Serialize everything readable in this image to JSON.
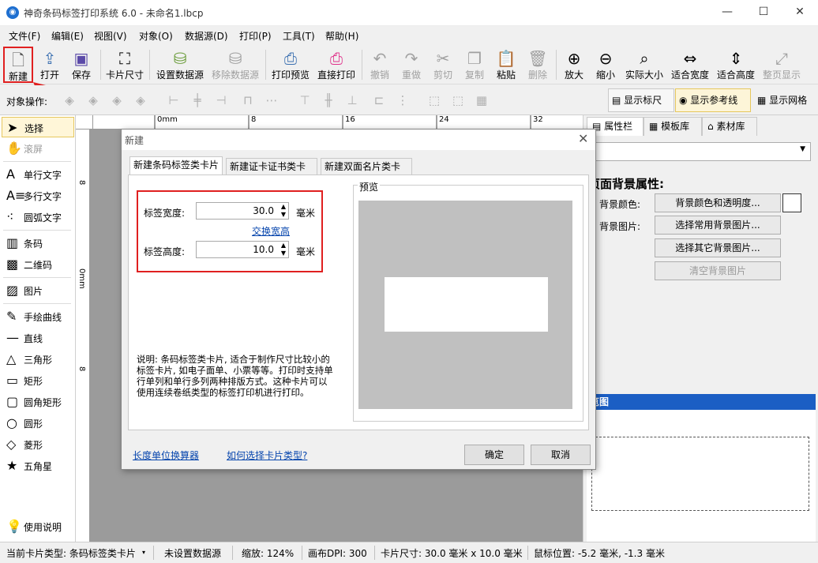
{
  "window": {
    "title": "神奇条码标签打印系统 6.0 - 未命名1.lbcp",
    "app_icon": "app-logo-icon"
  },
  "menu": [
    "文件(F)",
    "编辑(E)",
    "视图(V)",
    "对象(O)",
    "数据源(D)",
    "打印(P)",
    "工具(T)",
    "帮助(H)"
  ],
  "toolbar": {
    "new": "新建",
    "open": "打开",
    "save": "保存",
    "card_size": "卡片尺寸",
    "set_datasource": "设置数据源",
    "remove_datasource": "移除数据源",
    "print_preview": "打印预览",
    "direct_print": "直接打印",
    "undo": "撤销",
    "redo": "重做",
    "cut": "剪切",
    "copy": "复制",
    "paste": "粘贴",
    "delete": "删除",
    "zoom_in": "放大",
    "zoom_out": "缩小",
    "actual_size": "实际大小",
    "fit_width": "适合宽度",
    "fit_height": "适合高度",
    "full_page": "整页显示"
  },
  "objbar": {
    "label": "对象操作:",
    "show_ruler": "显示标尺",
    "show_guides": "显示参考线",
    "show_grid": "显示网格"
  },
  "tools": {
    "select": "选择",
    "scroll": "滚屏",
    "single_text": "单行文字",
    "multi_text": "多行文字",
    "arc_text": "圆弧文字",
    "barcode": "条码",
    "qrcode": "二维码",
    "image": "图片",
    "freehand": "手绘曲线",
    "line": "直线",
    "triangle": "三角形",
    "rect": "矩形",
    "round_rect": "圆角矩形",
    "circle": "圆形",
    "diamond": "菱形",
    "star": "五角星",
    "help": "使用说明"
  },
  "ruler": {
    "h_labels": [
      "0mm",
      "8",
      "16",
      "24",
      "32"
    ],
    "v_labels": [
      "8",
      "0mm",
      "8"
    ]
  },
  "right_panel": {
    "tabs": [
      "属性栏",
      "模板库",
      "素材库"
    ],
    "section_title": "页面背景属性:",
    "bg_color_label": "背景颜色:",
    "bg_color_btn": "背景颜色和透明度...",
    "bg_image_label": "背景图片:",
    "bg_common_btn": "选择常用背景图片...",
    "bg_other_btn": "选择其它背景图片...",
    "bg_clear_btn": "清空背景图片",
    "overview_title": "览图"
  },
  "dialog": {
    "title": "新建",
    "tabs": [
      "新建条码标签类卡片",
      "新建证卡证书类卡片",
      "新建双面名片类卡片"
    ],
    "width_label": "标签宽度:",
    "width_value": "30.0",
    "width_unit": "毫米",
    "swap_link": "交换宽高",
    "height_label": "标签高度:",
    "height_value": "10.0",
    "height_unit": "毫米",
    "preview_label": "预览",
    "description": "说明: 条码标签类卡片, 适合于制作尺寸比较小的标签卡片, 如电子面单、小票等等。打印时支持单行单列和单行多列两种排版方式。这种卡片可以使用连续卷纸类型的标签打印机进行打印。",
    "unit_calc_link": "长度单位换算器",
    "how_choose_link": "如何选择卡片类型?",
    "ok": "确定",
    "cancel": "取消"
  },
  "status": {
    "card_type": "当前卡片类型: 条码标签类卡片",
    "datasource": "未设置数据源",
    "zoom": "缩放: 124%",
    "dpi": "画布DPI: 300",
    "card_size": "卡片尺寸: 30.0 毫米 x 10.0 毫米",
    "mouse_pos": "鼠标位置: -5.2 毫米, -1.3 毫米"
  },
  "colors": {
    "highlight": "#e02020",
    "accent": "#1e6fd0"
  }
}
